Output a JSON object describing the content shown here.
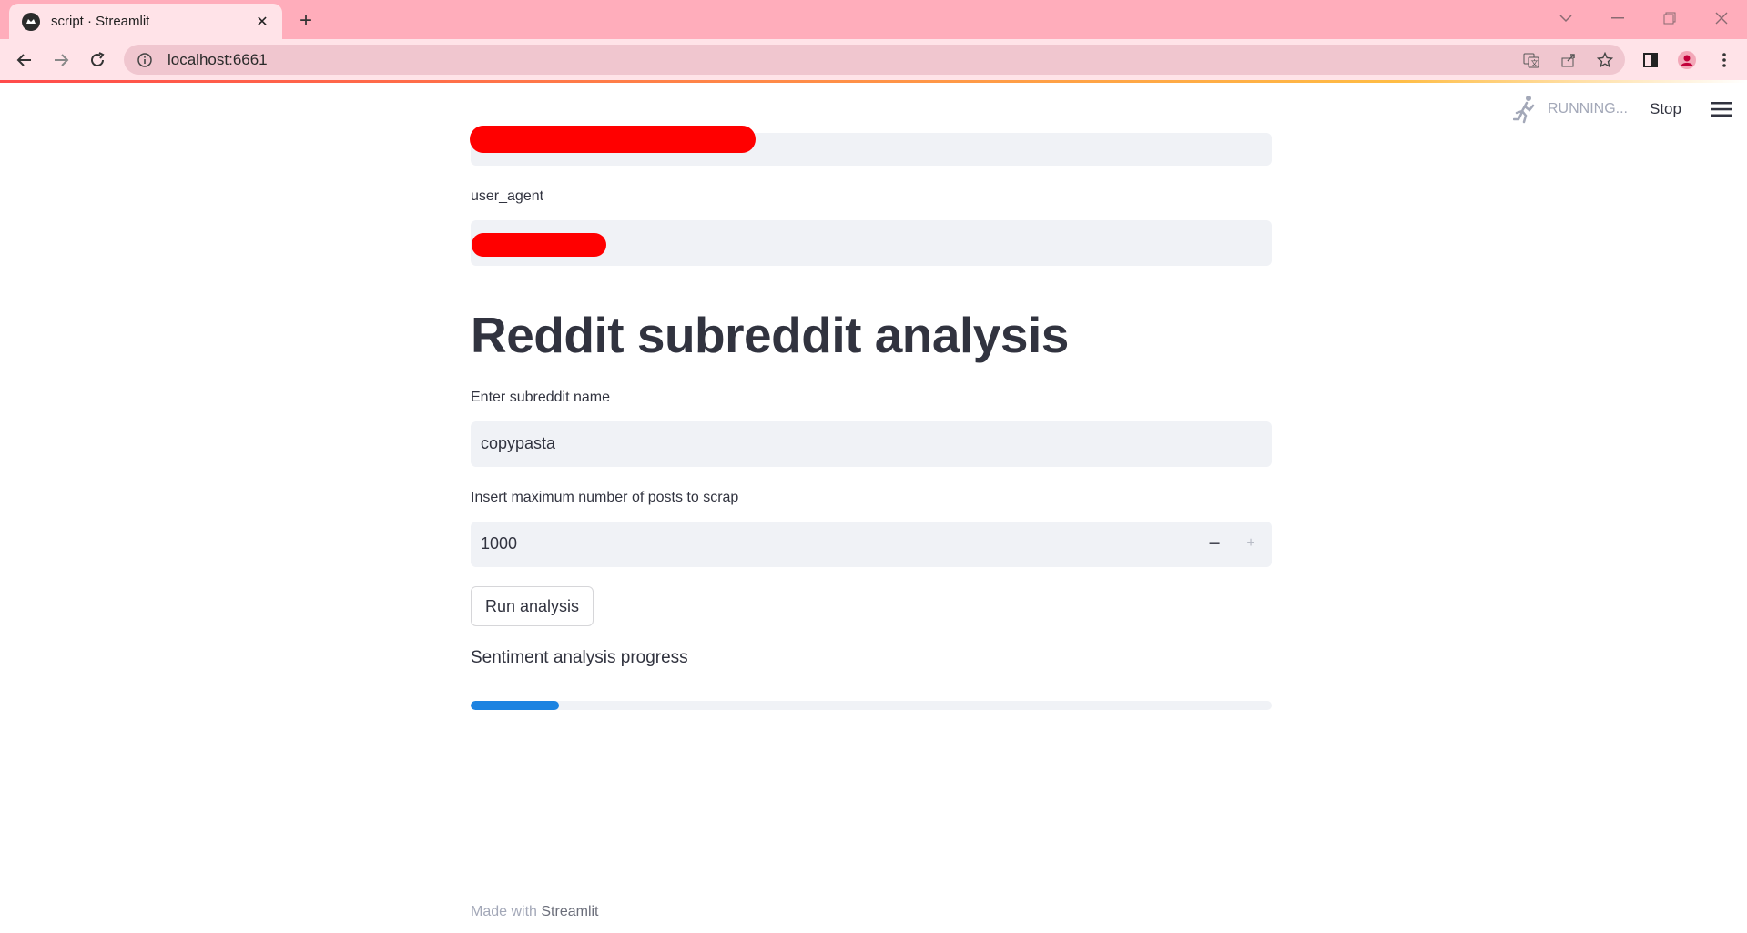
{
  "browser": {
    "tab_title": "script · Streamlit",
    "url": "localhost:6661",
    "accent": "#ffadbb"
  },
  "status": {
    "running_label": "RUNNING...",
    "stop_label": "Stop"
  },
  "fields": {
    "user_agent_label": "user_agent",
    "title": "Reddit subreddit analysis",
    "subreddit_label": "Enter subreddit name",
    "subreddit_value": "copypasta",
    "max_posts_label": "Insert maximum number of posts to scrap",
    "max_posts_value": "1000",
    "decrement_symbol": "−",
    "increment_symbol": "+"
  },
  "actions": {
    "run_label": "Run analysis"
  },
  "progress": {
    "label": "Sentiment analysis progress",
    "value": 0.11,
    "color": "#1c83e1"
  },
  "footer": {
    "prefix": "Made with",
    "brand": "Streamlit"
  }
}
